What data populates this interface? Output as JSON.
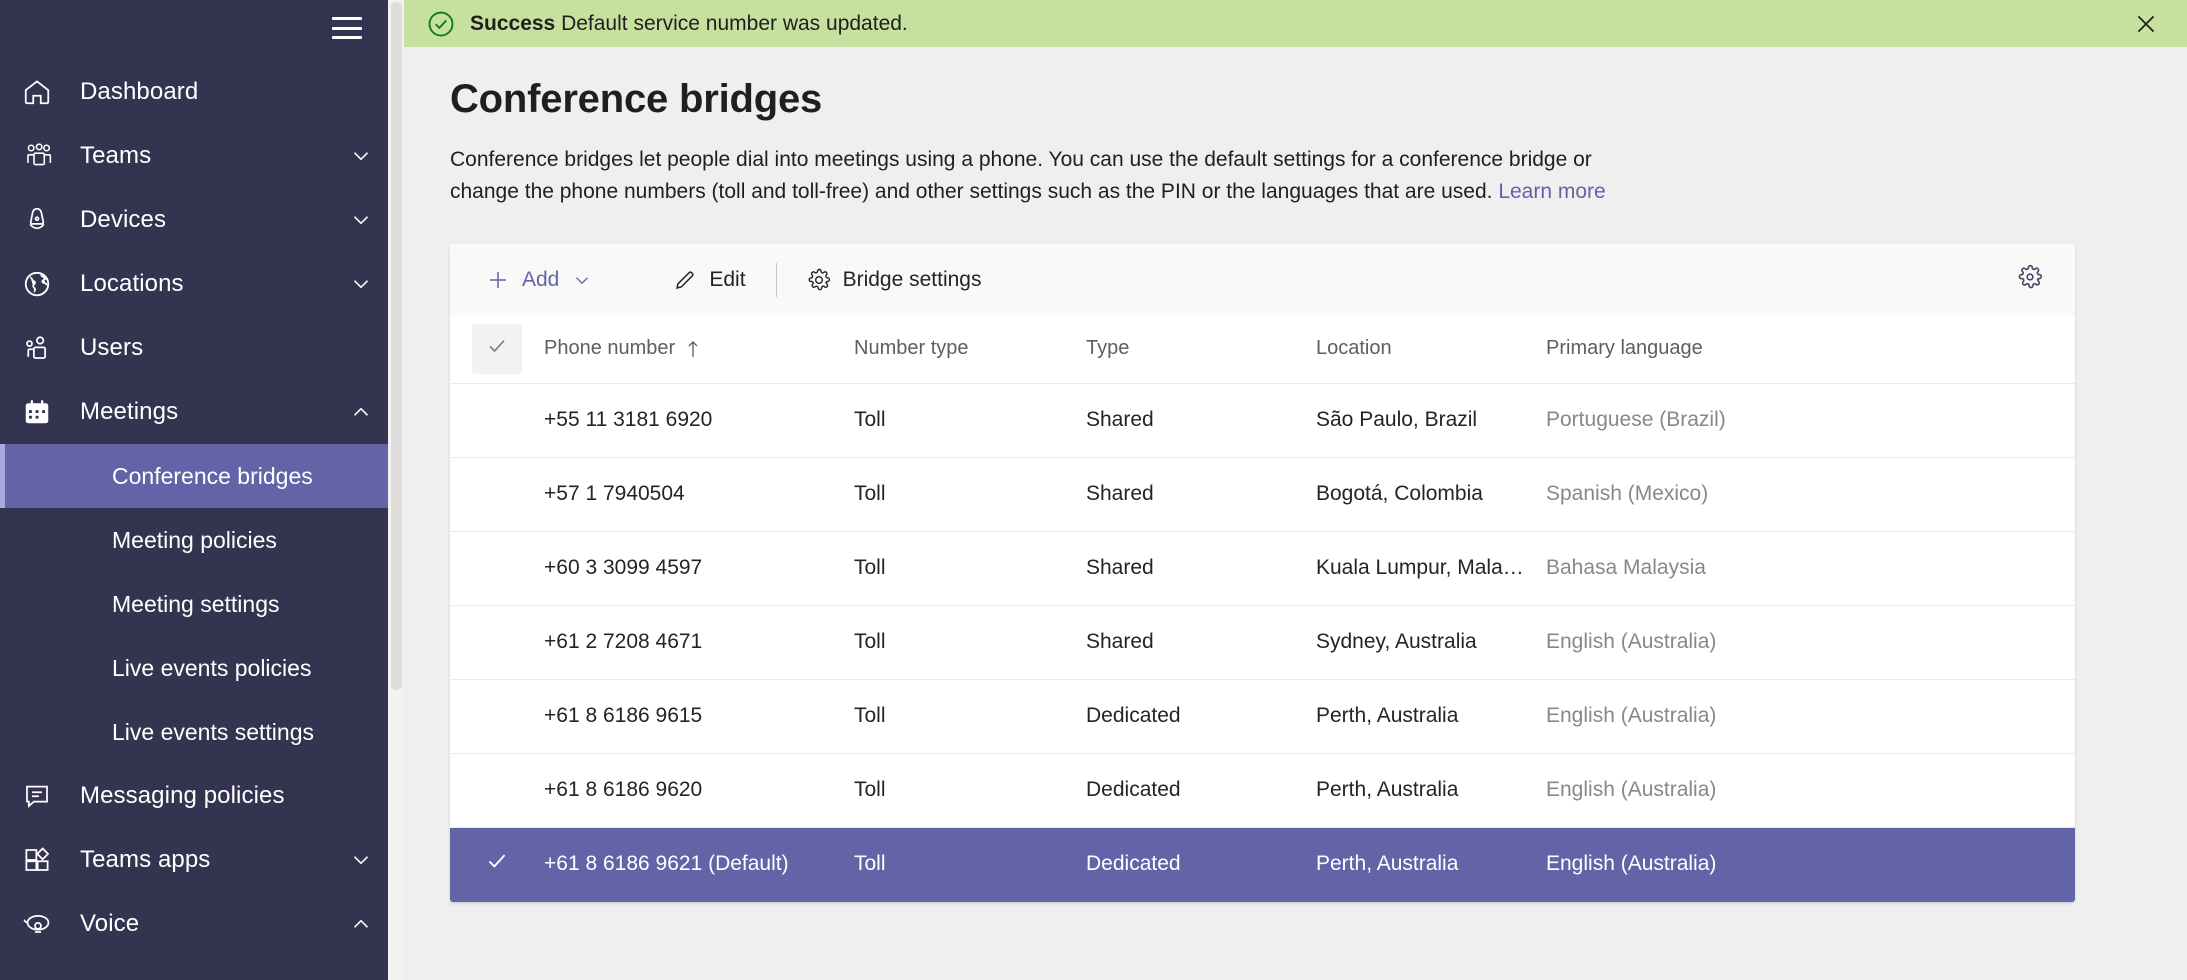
{
  "sidebar": {
    "menu_icon": "hamburger-icon",
    "items": [
      {
        "label": "Dashboard",
        "icon": "home-icon",
        "expandable": false,
        "expanded": false
      },
      {
        "label": "Teams",
        "icon": "teams-icon",
        "expandable": true,
        "expanded": false
      },
      {
        "label": "Devices",
        "icon": "devices-icon",
        "expandable": true,
        "expanded": false
      },
      {
        "label": "Locations",
        "icon": "globe-icon",
        "expandable": true,
        "expanded": false
      },
      {
        "label": "Users",
        "icon": "users-icon",
        "expandable": false,
        "expanded": false
      },
      {
        "label": "Meetings",
        "icon": "calendar-icon",
        "expandable": true,
        "expanded": true
      },
      {
        "label": "Messaging policies",
        "icon": "message-icon",
        "expandable": false,
        "expanded": false
      },
      {
        "label": "Teams apps",
        "icon": "apps-icon",
        "expandable": true,
        "expanded": false
      },
      {
        "label": "Voice",
        "icon": "phone-icon",
        "expandable": true,
        "expanded": true
      }
    ],
    "meetings_children": [
      {
        "label": "Conference bridges",
        "active": true
      },
      {
        "label": "Meeting policies",
        "active": false
      },
      {
        "label": "Meeting settings",
        "active": false
      },
      {
        "label": "Live events policies",
        "active": false
      },
      {
        "label": "Live events settings",
        "active": false
      }
    ],
    "active_color": "#6264a7",
    "background": "#343450"
  },
  "banner": {
    "status": "Success",
    "message": "Default service number was updated.",
    "icon": "checkmark-circle-icon",
    "close_icon": "close-icon",
    "background": "#c6e0a0"
  },
  "page": {
    "title": "Conference bridges",
    "description": "Conference bridges let people dial into meetings using a phone. You can use the default settings for a conference bridge or change the phone numbers (toll and toll-free) and other settings such as the PIN or the languages that are used.",
    "learn_more": "Learn more"
  },
  "toolbar": {
    "add_label": "Add",
    "add_icon": "plus-icon",
    "add_caret_icon": "chevron-down-icon",
    "edit_label": "Edit",
    "edit_icon": "pencil-icon",
    "bridge_settings_label": "Bridge settings",
    "bridge_settings_icon": "gear-icon",
    "settings_icon": "gear-icon"
  },
  "table": {
    "columns": [
      {
        "key": "phone",
        "label": "Phone number",
        "sorted": "asc"
      },
      {
        "key": "numtype",
        "label": "Number type",
        "sorted": ""
      },
      {
        "key": "type",
        "label": "Type",
        "sorted": ""
      },
      {
        "key": "loc",
        "label": "Location",
        "sorted": ""
      },
      {
        "key": "lang",
        "label": "Primary language",
        "sorted": ""
      }
    ],
    "select_all_icon": "checkmark-icon",
    "rows": [
      {
        "phone": "+55 11 3181 6920",
        "numtype": "Toll",
        "type": "Shared",
        "loc": "São Paulo, Brazil",
        "lang": "Portuguese (Brazil)",
        "selected": false
      },
      {
        "phone": "+57 1 7940504",
        "numtype": "Toll",
        "type": "Shared",
        "loc": "Bogotá, Colombia",
        "lang": "Spanish (Mexico)",
        "selected": false
      },
      {
        "phone": "+60 3 3099 4597",
        "numtype": "Toll",
        "type": "Shared",
        "loc": "Kuala Lumpur, Malaysia",
        "lang": "Bahasa Malaysia",
        "selected": false
      },
      {
        "phone": "+61 2 7208 4671",
        "numtype": "Toll",
        "type": "Shared",
        "loc": "Sydney, Australia",
        "lang": "English (Australia)",
        "selected": false
      },
      {
        "phone": "+61 8 6186 9615",
        "numtype": "Toll",
        "type": "Dedicated",
        "loc": "Perth, Australia",
        "lang": "English (Australia)",
        "selected": false
      },
      {
        "phone": "+61 8 6186 9620",
        "numtype": "Toll",
        "type": "Dedicated",
        "loc": "Perth, Australia",
        "lang": "English (Australia)",
        "selected": false
      },
      {
        "phone": "+61 8 6186 9621 (Default)",
        "numtype": "Toll",
        "type": "Dedicated",
        "loc": "Perth, Australia",
        "lang": "English (Australia)",
        "selected": true
      }
    ]
  }
}
